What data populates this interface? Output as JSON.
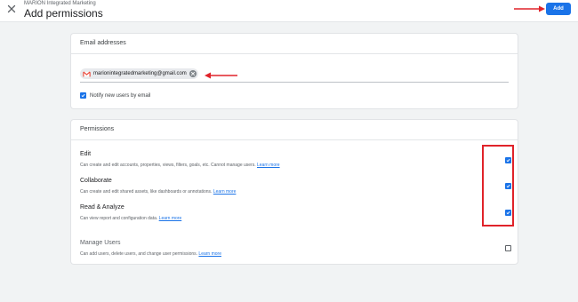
{
  "header": {
    "overline": "MARION Integrated Marketing",
    "title": "Add permissions",
    "add_label": "Add"
  },
  "email_section": {
    "heading": "Email addresses",
    "chip_email": "marionintegratedmarketing@gmail.com",
    "notify_label": "Notify new users by email",
    "notify_checked": true
  },
  "permissions": {
    "heading": "Permissions",
    "items": [
      {
        "label": "Edit",
        "description": "Can create and edit accounts, properties, views, filters, goals, etc. Cannot manage users.",
        "link": "Learn more",
        "checked": true
      },
      {
        "label": "Collaborate",
        "description": "Can create and edit shared assets, like dashboards or annotations.",
        "link": "Learn more",
        "checked": true
      },
      {
        "label": "Read & Analyze",
        "description": "Can view report and configuration data.",
        "link": "Learn more",
        "checked": true
      },
      {
        "label": "Manage Users",
        "description": "Can add users, delete users, and change user permissions.",
        "link": "Learn more",
        "checked": false
      }
    ]
  },
  "icons": {
    "close": "close-icon",
    "avatar": "gmail-icon",
    "chip_remove": "cancel-icon",
    "check": "check-icon"
  },
  "colors": {
    "accent": "#1a73e8",
    "annotation": "#e0232a",
    "background": "#f1f3f4"
  }
}
